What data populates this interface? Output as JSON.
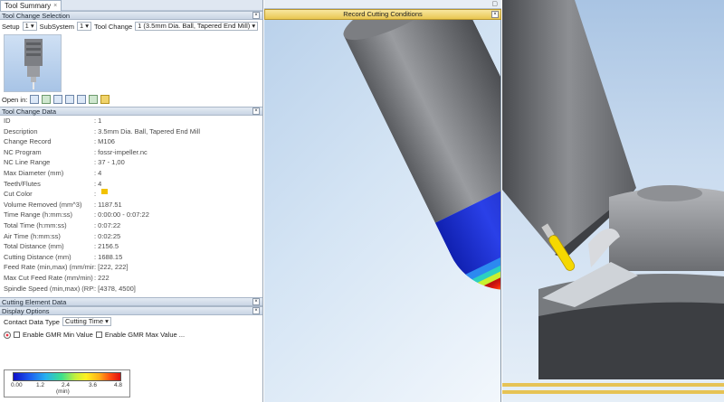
{
  "window": {
    "tab_label": "Tool Summary",
    "tab_close": "×",
    "close_symbol": "×",
    "minimize_symbol": "▢"
  },
  "record_bar": {
    "title": "Record Cutting Conditions"
  },
  "tool_change_selection": {
    "header": "Tool Change Selection",
    "setup_label": "Setup",
    "setup_value": "1",
    "subsystem_label": "SubSystem",
    "subsystem_value": "1",
    "tool_change_label": "Tool Change",
    "tool_change_value": "1 (3.5mm Dia. Ball, Tapered End Mill)",
    "open_in_label": "Open in:"
  },
  "tool_change_data": {
    "header": "Tool Change Data",
    "rows": [
      {
        "key": "ID",
        "value": ": 1"
      },
      {
        "key": "Description",
        "value": ": 3.5mm Dia. Ball, Tapered End Mill"
      },
      {
        "key": "Change Record",
        "value": ": M106"
      },
      {
        "key": "NC Program",
        "value": ": fossr-impeller.nc"
      },
      {
        "key": "NC Line Range",
        "value": ": 37 - 1,00"
      },
      {
        "key": "Max Diameter (mm)",
        "value": ": 4"
      },
      {
        "key": "Teeth/Flutes",
        "value": ": 4"
      },
      {
        "key": "Cut Color",
        "value": ":"
      },
      {
        "key": "Volume Removed (mm^3)",
        "value": ": 1187.51"
      },
      {
        "key": "Time Range (h:mm:ss)",
        "value": ": 0:00:00 - 0:07:22"
      },
      {
        "key": "Total Time (h:mm:ss)",
        "value": ": 0:07:22"
      },
      {
        "key": "Air Time (h:mm:ss)",
        "value": ": 0:02:25"
      },
      {
        "key": "Total Distance (mm)",
        "value": ": 2156.5"
      },
      {
        "key": "Cutting Distance (mm)",
        "value": ": 1688.15"
      },
      {
        "key": "Feed Rate (min,max) (mm/min)",
        "value": ": [222, 222]"
      },
      {
        "key": "Max Cut Feed Rate (mm/min)",
        "value": ": 222"
      },
      {
        "key": "Spindle Speed (min,max) (RPM)",
        "value": ": [4378, 4500]"
      }
    ],
    "cut_color": "#f2c200"
  },
  "cutting_element_data": {
    "header": "Cutting Element Data"
  },
  "display_options": {
    "header": "Display Options",
    "contact_label": "Contact Data Type",
    "contact_value": "Cutting Time",
    "enable_min_label": "Enable GMR Min Value",
    "enable_max_label": "Enable GMR Max Value ..."
  },
  "legend": {
    "ticks": [
      "0.00",
      "1.2",
      "2.4",
      "3.6",
      "4.8"
    ],
    "unit": "(min)"
  },
  "colors": {
    "panel_header": "#c9d5e4",
    "record_bar": "#e9c650",
    "tool_shank": "#8a8a8a",
    "tool_blue": "#1a2ec8"
  }
}
